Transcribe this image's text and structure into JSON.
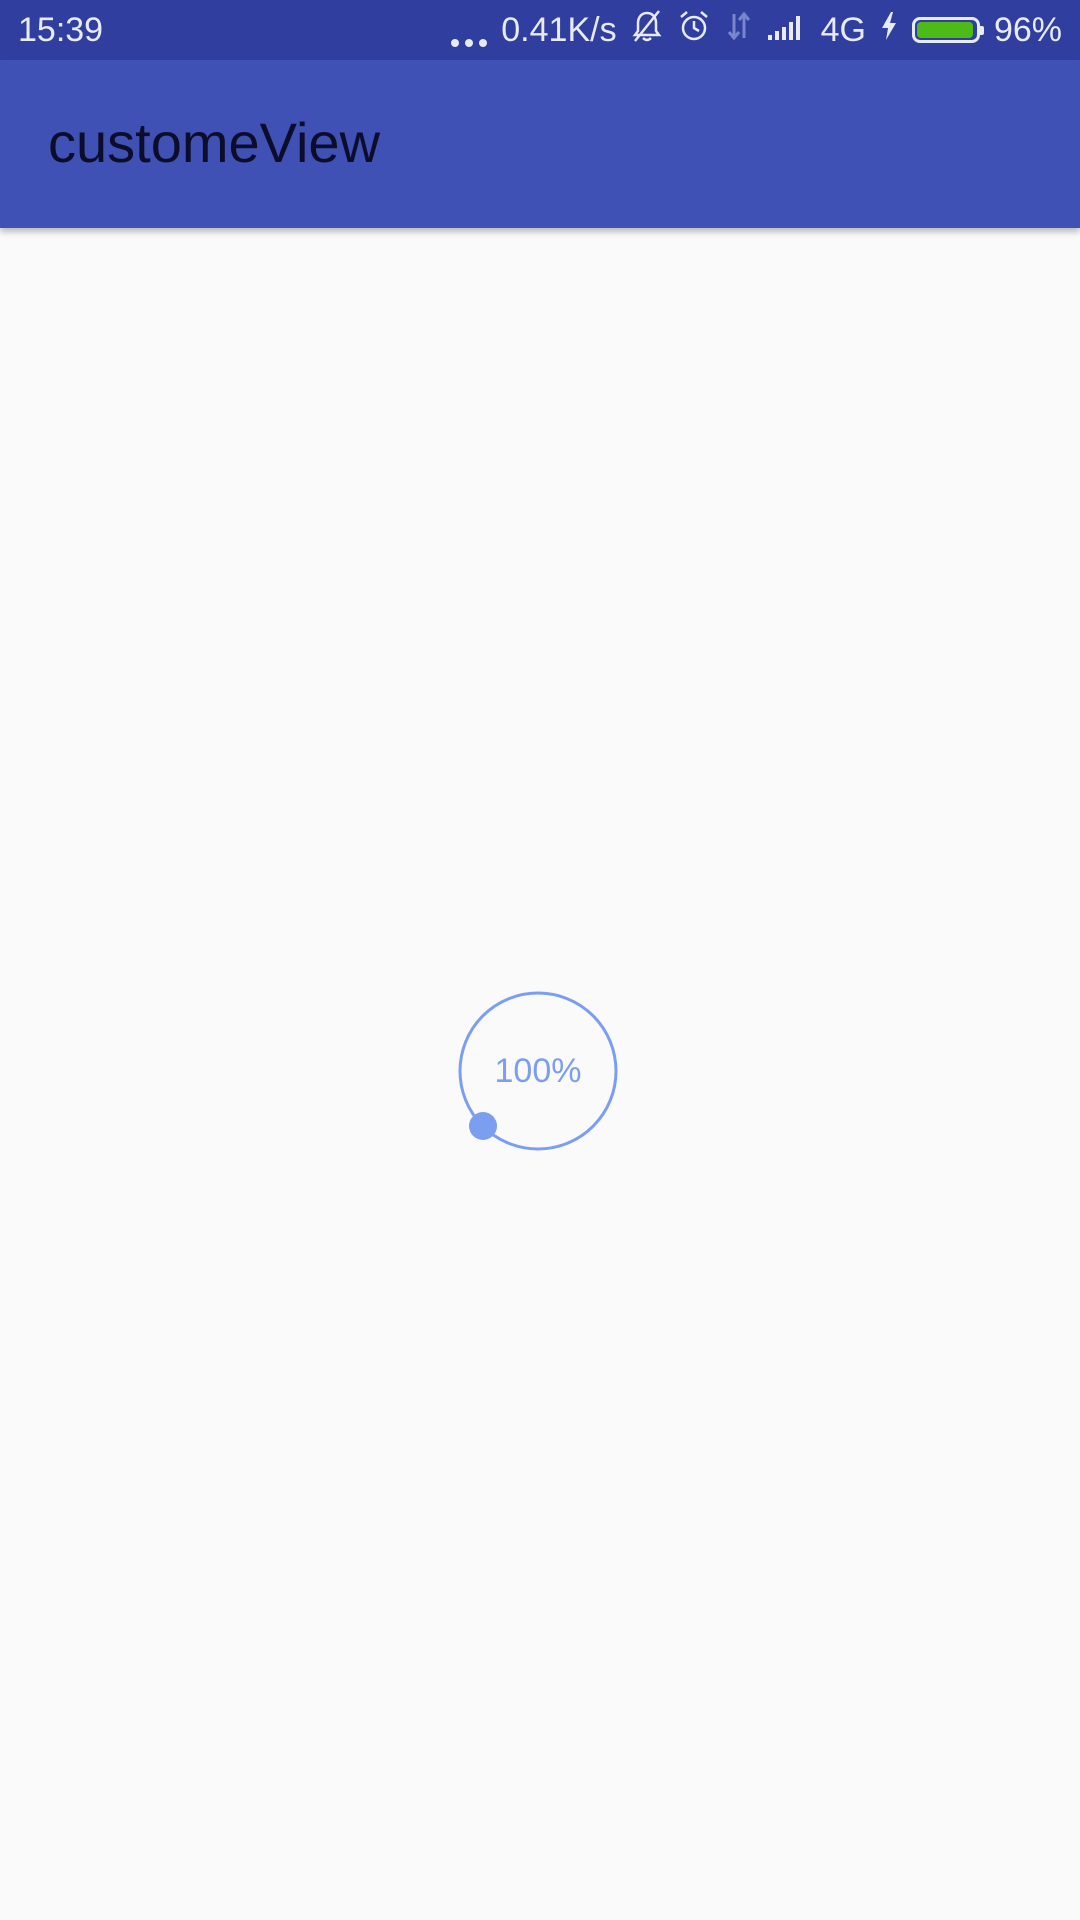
{
  "status_bar": {
    "time": "15:39",
    "network_speed": "0.41K/s",
    "network_type": "4G",
    "battery_percent": "96%",
    "battery_level": 0.96,
    "icons": [
      "more-dots-icon",
      "muted-bell-icon",
      "alarm-icon",
      "data-arrows-icon",
      "signal-icon",
      "charging-icon",
      "battery-icon"
    ]
  },
  "app_bar": {
    "title": "customeView"
  },
  "progress": {
    "label": "100%",
    "value": 1.0,
    "color": "#7b9ef0"
  },
  "colors": {
    "status_bar": "#303f9f",
    "app_bar": "#3f51b5",
    "background": "#fafafa",
    "battery": "#4cbb17"
  }
}
